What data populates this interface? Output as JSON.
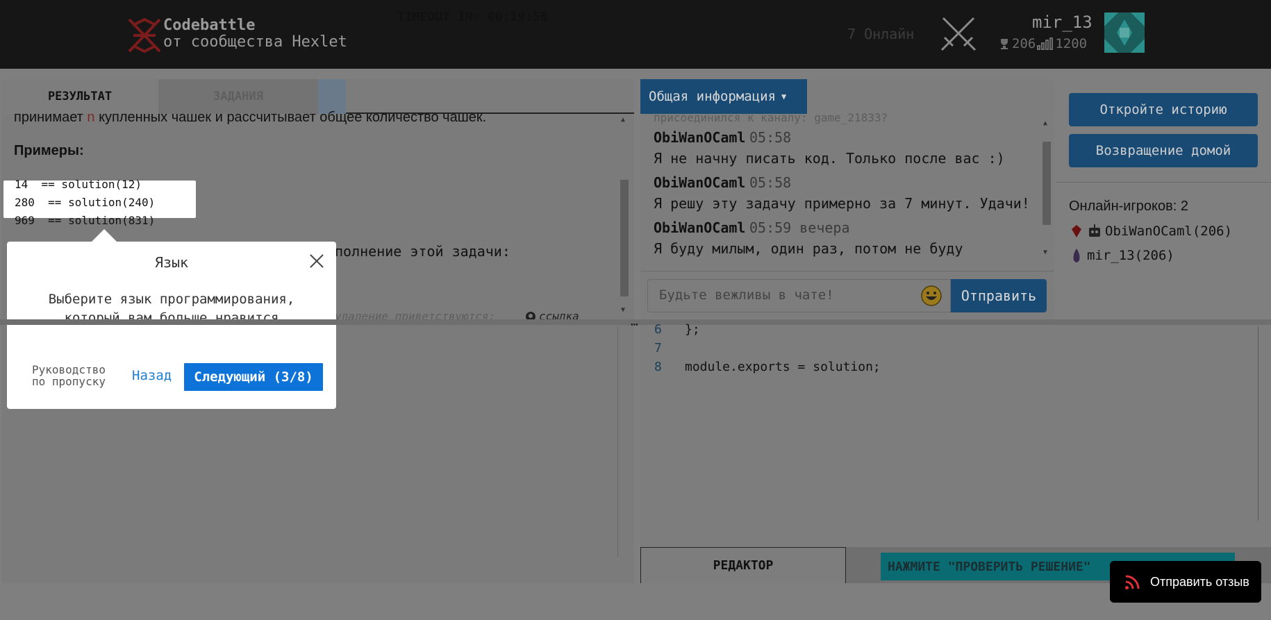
{
  "header": {
    "logo_title": "Codebattle",
    "logo_subtitle": "от сообщества Hexlet",
    "online": "7 Онлайн",
    "username": "mir_13",
    "rating": "206",
    "score": "1200"
  },
  "left": {
    "tabs": {
      "result": "РЕЗУЛЬТАТ",
      "tasks": "ЗАДАНИЯ"
    },
    "timeout": "TIMEOUT IN: 00:19:58",
    "task_text_before": "принимает ",
    "task_text_var": "n",
    "task_text_after": " купленных чашек и рассчитывает общее количество чашек.",
    "examples_heading": "Примеры:",
    "examples": [
      "14  == solution(12)",
      "280  == solution(240)",
      "969  == solution(831)"
    ],
    "partial_text": "полнение этой задачи:",
    "faded_text": "удаление приветствуются:",
    "faded_link": "ссылка"
  },
  "popover": {
    "title": "Язык",
    "description_line1": "Выберите язык программирования,",
    "description_line2": "который вам больше нравится",
    "skip_line1": "Руководство",
    "skip_line2": "по пропуску",
    "back": "Назад",
    "next": "Следующий (3/8)"
  },
  "chat": {
    "dropdown": "Общая информация",
    "faded_top": "присоединился к каналу: game_21833?",
    "messages": [
      {
        "author": "ObiWanOCaml",
        "time": "05:58",
        "text": "Я не начну писать код. Только после вас :)"
      },
      {
        "author": "ObiWanOCaml",
        "time": "05:58",
        "text": "Я решу эту задачу примерно за 7 минут. Удачи!"
      },
      {
        "author": "ObiWanOCaml",
        "time": "05:59 вечера",
        "text": "Я буду милым, один раз, потом не буду"
      }
    ],
    "input_placeholder": "Будьте вежливы в чате!",
    "send": "Отправить"
  },
  "side": {
    "history_button": "Откройте историю",
    "home_button": "Возвращение домой",
    "players_heading": "Онлайн-игроков: 2",
    "players": [
      {
        "name": "ObiWanOCaml(206)",
        "lang_icon": "ruby-icon",
        "bot_icon": "robot-icon"
      },
      {
        "name": "mir_13(206)",
        "lang_icon": "elixir-icon"
      }
    ]
  },
  "editor": {
    "lines": [
      {
        "num": "6",
        "code": "};"
      },
      {
        "num": "7",
        "code": ""
      },
      {
        "num": "8",
        "code": "module.exports = solution;"
      }
    ],
    "tab": "РЕДАКТОР",
    "check_banner": "НАЖМИТЕ \"ПРОВЕРИТЬ РЕШЕНИЕ\""
  },
  "feedback": "Отправить отзыв",
  "colors": {
    "primary": "#184a74",
    "popover_button": "#0d73d8",
    "header_bg": "#161616",
    "overlay": "#7f7f7f"
  }
}
